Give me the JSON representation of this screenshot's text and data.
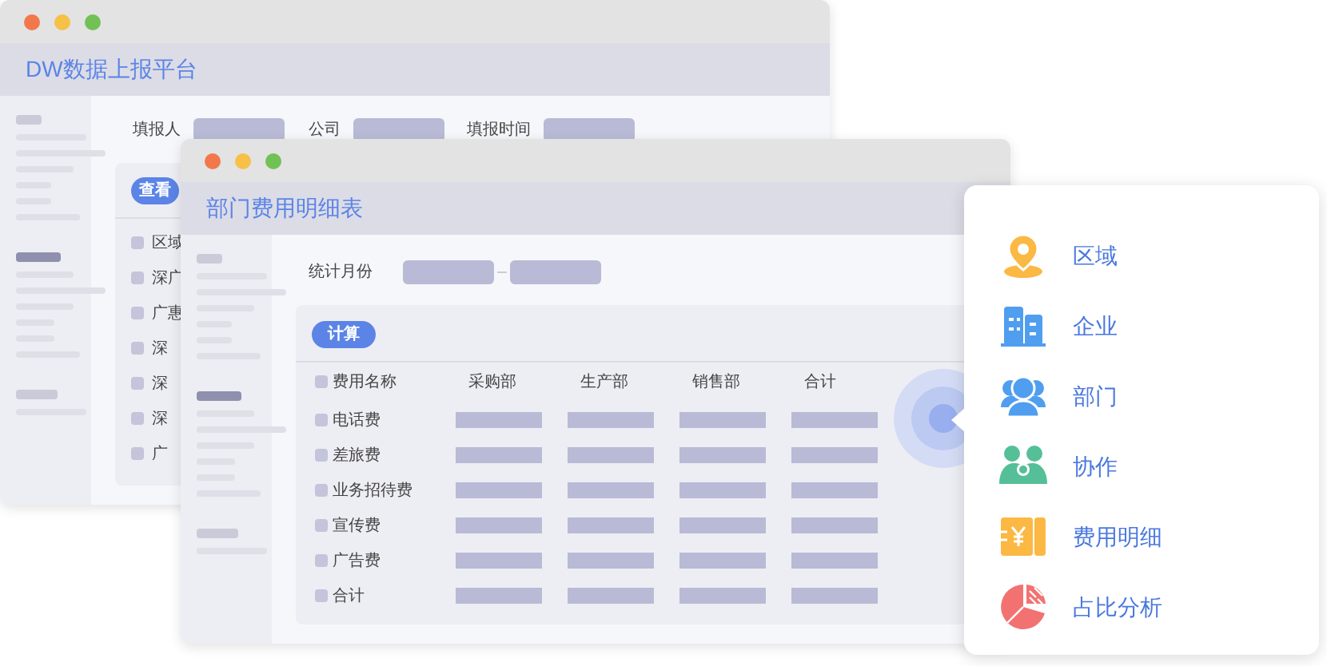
{
  "back_window": {
    "title": "DW数据上报平台",
    "form_labels": [
      "填报人",
      "公司",
      "填报时间"
    ],
    "button": "查看",
    "rows": [
      {
        "label": "区域",
        "checked": false
      },
      {
        "label": "深广",
        "checked": false
      },
      {
        "label": "广惠",
        "checked": false
      },
      {
        "label": "深",
        "checked": false
      },
      {
        "label": "深",
        "checked": false
      },
      {
        "label": "深",
        "checked": false
      },
      {
        "label": "广",
        "checked": false
      }
    ]
  },
  "front_window": {
    "title": "部门费用明细表",
    "filter_label": "统计月份",
    "button": "计算",
    "header_checked": false,
    "columns": [
      "费用名称",
      "采购部",
      "生产部",
      "销售部",
      "合计"
    ],
    "rows": [
      {
        "label": "电话费",
        "checked": false
      },
      {
        "label": "差旅费",
        "checked": false
      },
      {
        "label": "业务招待费",
        "checked": false
      },
      {
        "label": "宣传费",
        "checked": false
      },
      {
        "label": "广告费",
        "checked": false
      },
      {
        "label": "合计",
        "checked": false
      }
    ]
  },
  "menu": [
    {
      "label": "区域",
      "kind": "pin"
    },
    {
      "label": "企业",
      "kind": "building"
    },
    {
      "label": "部门",
      "kind": "people"
    },
    {
      "label": "协作",
      "kind": "team"
    },
    {
      "label": "费用明细",
      "kind": "money"
    },
    {
      "label": "占比分析",
      "kind": "pie"
    }
  ]
}
